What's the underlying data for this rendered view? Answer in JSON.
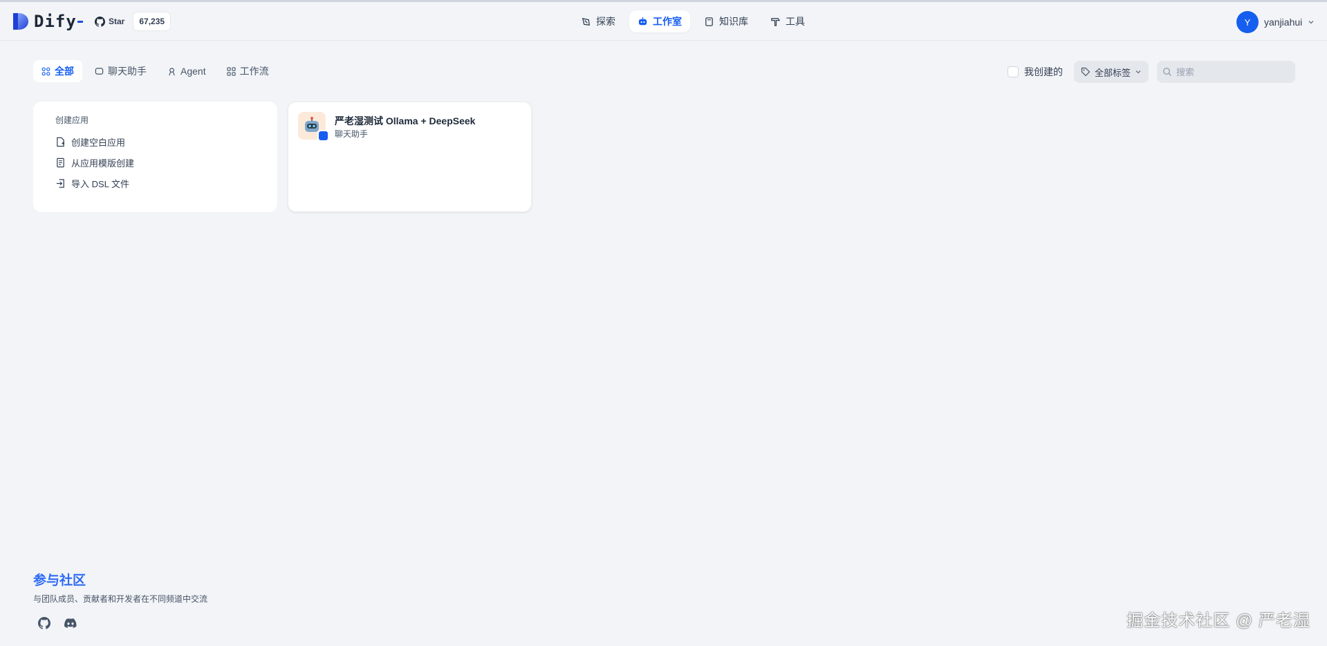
{
  "header": {
    "logo_text": "Dify",
    "github": {
      "star_label": "Star",
      "star_count": "67,235"
    },
    "nav": [
      {
        "label": "探索",
        "icon": "compass-icon",
        "active": false
      },
      {
        "label": "工作室",
        "icon": "robot-icon",
        "active": true
      },
      {
        "label": "知识库",
        "icon": "book-icon",
        "active": false
      },
      {
        "label": "工具",
        "icon": "hammer-icon",
        "active": false
      }
    ],
    "user": {
      "initial": "Y",
      "name": "yanjiahui"
    }
  },
  "filters": {
    "tabs": [
      {
        "label": "全部",
        "active": true
      },
      {
        "label": "聊天助手",
        "active": false
      },
      {
        "label": "Agent",
        "active": false
      },
      {
        "label": "工作流",
        "active": false
      }
    ],
    "mine_label": "我创建的",
    "tags_label": "全部标签",
    "search_placeholder": "搜索"
  },
  "create_card": {
    "title": "创建应用",
    "items": [
      {
        "label": "创建空白应用",
        "icon": "file-plus-icon"
      },
      {
        "label": "从应用模版创建",
        "icon": "template-icon"
      },
      {
        "label": "导入 DSL 文件",
        "icon": "import-icon"
      }
    ]
  },
  "apps": [
    {
      "name": "严老湿测试 Ollama + DeepSeek",
      "type": "聊天助手",
      "icon": "robot-emoji-icon"
    }
  ],
  "community": {
    "title": "参与社区",
    "description": "与团队成员、贡献者和开发者在不同频道中交流"
  },
  "watermark": "掘金技术社区 @ 严老湿",
  "colors": {
    "accent": "#155eef",
    "background": "#f2f4f7",
    "community_title": "#2e6bf6"
  }
}
